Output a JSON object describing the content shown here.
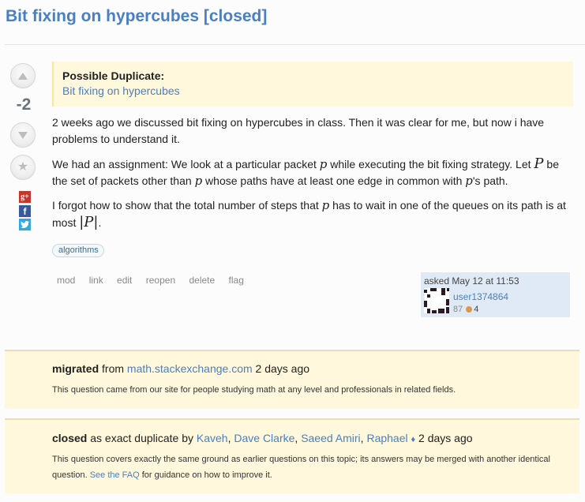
{
  "question": {
    "title": "Bit fixing on hypercubes [closed]",
    "votes": "-2",
    "duplicate_notice": {
      "label": "Possible Duplicate:",
      "link": "Bit fixing on hypercubes"
    },
    "body": {
      "p1": "2 weeks ago we discussed bit fixing on hypercubes in class. Then it was clear for me, but now i have problems to understand it.",
      "p2_a": "We had an assignment: We look at a particular packet ",
      "p2_b": " while executing the bit fixing strategy. Let ",
      "p2_c": " be the set of packets other than ",
      "p2_d": " whose paths have at least one edge in common with ",
      "p2_e": "'s path.",
      "p3_a": "I forgot how to show that the total number of steps that ",
      "p3_b": " has to wait in one of the queues on its path is at most ",
      "p3_c": ".",
      "math_p": "p",
      "math_P": "P",
      "math_absP": "|P|"
    },
    "tags": [
      "algorithms"
    ],
    "menu": [
      "mod",
      "link",
      "edit",
      "reopen",
      "delete",
      "flag"
    ],
    "owner": {
      "asked": "asked May 12 at 11:53",
      "name": "user1374864",
      "reputation": "87",
      "bronze_badges": "4"
    },
    "share": {
      "google": "g+",
      "facebook": "f",
      "twitter": "t"
    }
  },
  "notices": {
    "migrated": {
      "keyword": "migrated",
      "from": " from ",
      "site": "math.stackexchange.com",
      "when": " 2 days ago",
      "description": "This question came from our site for people studying math at any level and professionals in related fields."
    },
    "closed": {
      "keyword": "closed",
      "reason": " as exact duplicate by ",
      "closers": [
        "Kaveh",
        "Dave Clarke",
        "Saeed Amiri",
        "Raphael"
      ],
      "moderator_mark": "♦",
      "when": " 2 days ago",
      "description": "This question covers exactly the same ground as earlier questions on this topic; its answers may be merged with another identical question. ",
      "faq_link": "See the FAQ",
      "description_tail": " for guidance on how to improve it."
    }
  }
}
